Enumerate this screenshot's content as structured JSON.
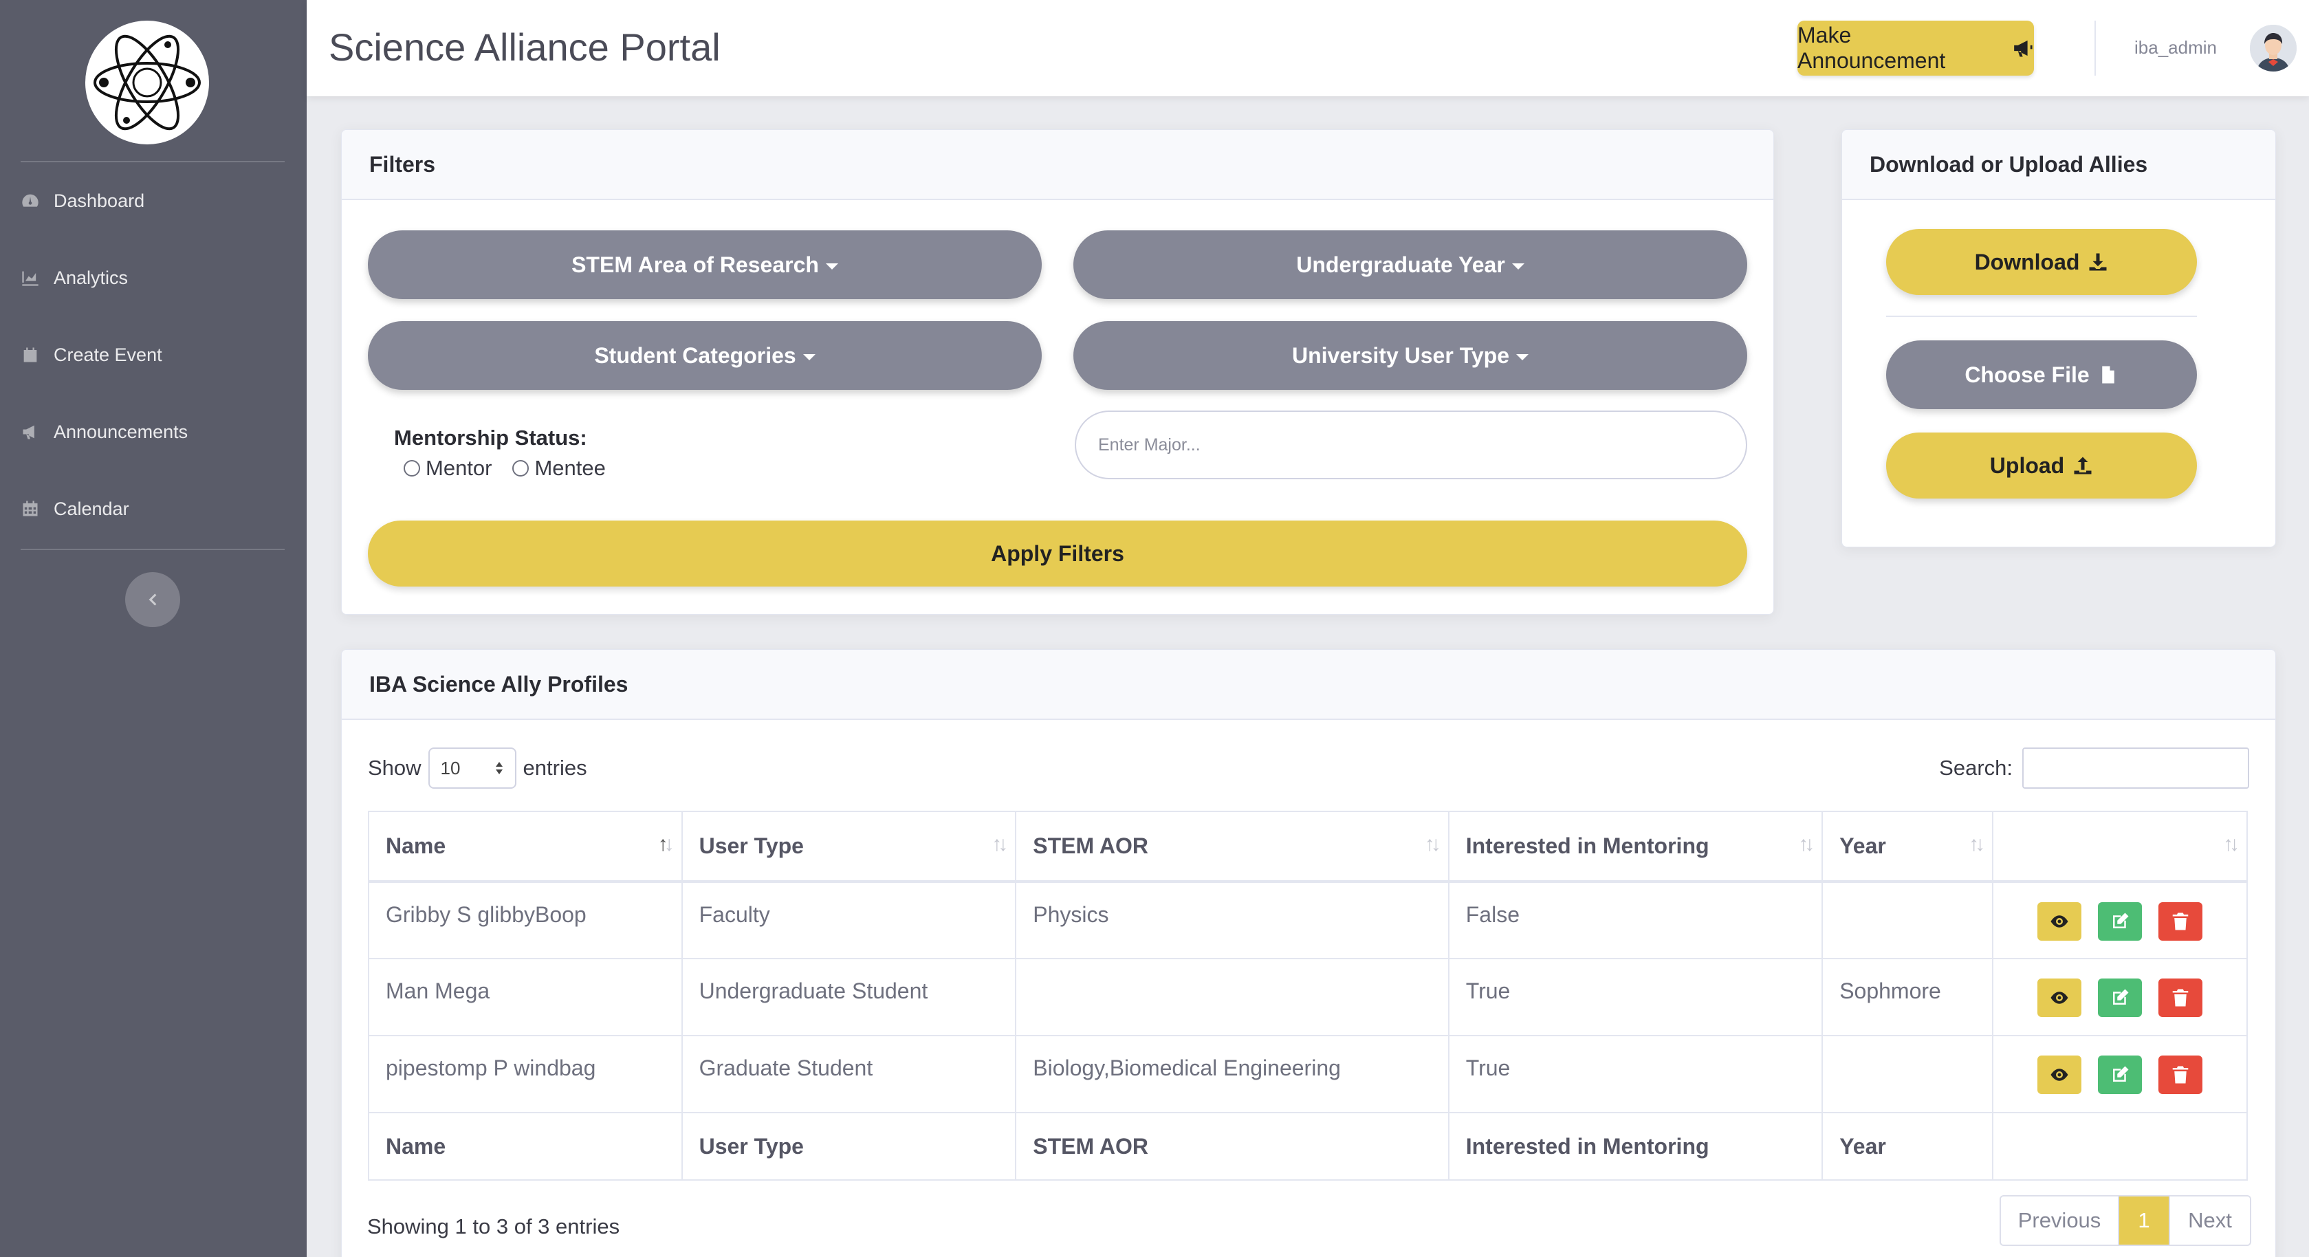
{
  "app": {
    "title": "Science Alliance Portal"
  },
  "sidebar": {
    "items": [
      {
        "label": "Dashboard",
        "icon": "tachometer-icon"
      },
      {
        "label": "Analytics",
        "icon": "area-chart-icon"
      },
      {
        "label": "Create Event",
        "icon": "calendar-icon"
      },
      {
        "label": "Announcements",
        "icon": "bullhorn-icon"
      },
      {
        "label": "Calendar",
        "icon": "calendar-grid-icon"
      }
    ]
  },
  "topbar": {
    "announce_label": "Make Announcement",
    "username": "iba_admin"
  },
  "filters": {
    "title": "Filters",
    "stem_label": "STEM Area of Research",
    "year_label": "Undergraduate Year",
    "categories_label": "Student Categories",
    "usertype_label": "University User Type",
    "mentorship_label": "Mentorship Status:",
    "mentor_option": "Mentor",
    "mentee_option": "Mentee",
    "major_placeholder": "Enter Major...",
    "apply_label": "Apply Filters"
  },
  "allies": {
    "title": "Download or Upload Allies",
    "download_label": "Download",
    "choose_label": "Choose File",
    "upload_label": "Upload"
  },
  "profiles": {
    "title": "IBA Science Ally Profiles",
    "show_label": "Show",
    "entries_value": "10",
    "entries_label": "entries",
    "search_label": "Search:",
    "columns": [
      "Name",
      "User Type",
      "STEM AOR",
      "Interested in Mentoring",
      "Year"
    ],
    "rows": [
      {
        "name": "Gribby S glibbyBoop",
        "user_type": "Faculty",
        "stem_aor": "Physics",
        "mentoring": "False",
        "year": ""
      },
      {
        "name": "Man Mega",
        "user_type": "Undergraduate Student",
        "stem_aor": "",
        "mentoring": "True",
        "year": "Sophmore"
      },
      {
        "name": "pipestomp P windbag",
        "user_type": "Graduate Student",
        "stem_aor": "Biology,Biomedical Engineering",
        "mentoring": "True",
        "year": ""
      }
    ],
    "info": "Showing 1 to 3 of 3 entries",
    "pager": {
      "prev": "Previous",
      "current": "1",
      "next": "Next"
    }
  },
  "colors": {
    "accent": "#e6cb52",
    "sidebar": "#5a5c69",
    "pill_gray": "#858796",
    "edit": "#4dbd74",
    "delete": "#e74a3b"
  }
}
